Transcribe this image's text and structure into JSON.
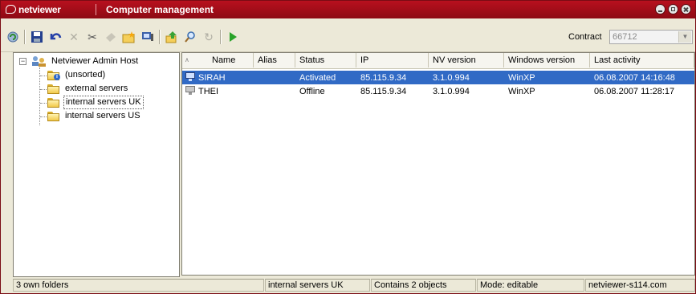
{
  "titlebar": {
    "brand": "netviewer",
    "title": "Computer management"
  },
  "toolbar": {
    "icons": [
      "refresh-icon",
      "save-icon",
      "undo-icon",
      "delete-icon",
      "cut-icon",
      "copy-icon",
      "new-folder-icon",
      "properties-icon",
      "upload-icon",
      "search-icon",
      "sync-icon",
      "play-icon"
    ],
    "contract_label": "Contract",
    "contract_value": "66712"
  },
  "tree": {
    "root": "Netviewer Admin Host",
    "items": [
      "(unsorted)",
      "external servers",
      "internal servers UK",
      "internal servers US"
    ],
    "selected": "internal servers UK"
  },
  "list": {
    "columns": [
      "Name",
      "Alias",
      "Status",
      "IP",
      "NV version",
      "Windows version",
      "Last activity"
    ],
    "rows": [
      {
        "name": "SIRAH",
        "alias": "",
        "status": "Activated",
        "ip": "85.115.9.34",
        "nv": "3.1.0.994",
        "win": "WinXP",
        "last": "06.08.2007 14:16:48",
        "selected": true
      },
      {
        "name": "THEI",
        "alias": "",
        "status": "Offline",
        "ip": "85.115.9.34",
        "nv": "3.1.0.994",
        "win": "WinXP",
        "last": "06.08.2007 11:28:17",
        "selected": false
      }
    ]
  },
  "statusbar": {
    "folders": "3 own folders",
    "current": "internal servers UK",
    "objects": "Contains 2 objects",
    "mode": "Mode: editable",
    "server": "netviewer-s114.com"
  },
  "colors": {
    "titlebar": "#a30d1a",
    "selection": "#316ac5"
  }
}
